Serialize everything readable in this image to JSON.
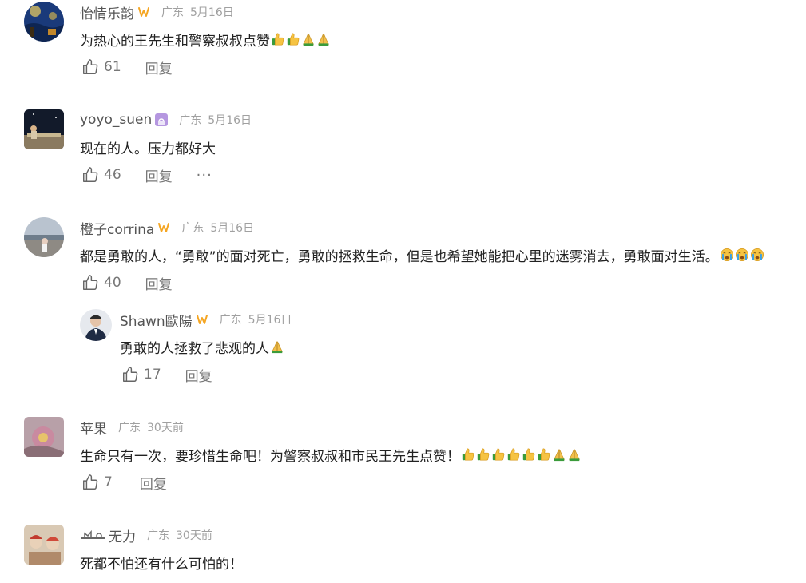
{
  "comments": [
    {
      "name": "怡情乐韵",
      "badge": "w",
      "location": "广东",
      "date": "5月16日",
      "text": "为热心的王先生和警察叔叔点赞",
      "emojis": [
        "thumbs-up",
        "thumbs-up",
        "pray",
        "pray"
      ],
      "likes": "61",
      "reply": "回复"
    },
    {
      "name": "yoyo_suen",
      "badge": "libra",
      "location": "广东",
      "date": "5月16日",
      "text": "现在的人。压力都好大",
      "emojis": [],
      "likes": "46",
      "reply": "回复",
      "more": "···"
    },
    {
      "name": "橙子corrina",
      "badge": "w",
      "location": "广东",
      "date": "5月16日",
      "text": "都是勇敢的人，“勇敢”的面对死亡，勇敢的拯救生命，但是也希望她能把心里的迷雾消去，勇敢面对生活。",
      "emojis": [
        "crying",
        "crying",
        "crying"
      ],
      "likes": "40",
      "reply": "回复"
    },
    {
      "name": "Shawn歐陽",
      "badge": "w",
      "location": "广东",
      "date": "5月16日",
      "text": "勇敢的人拯救了悲观的人",
      "emojis": [
        "pray"
      ],
      "likes": "17",
      "reply": "回复"
    },
    {
      "name": "苹果",
      "location": "广东",
      "date": "30天前",
      "text": "生命只有一次，要珍惜生命吧！为警察叔叔和市民王先生点赞！",
      "emojis": [
        "thumbs-up",
        "thumbs-up",
        "thumbs-up",
        "thumbs-up",
        "thumbs-up",
        "thumbs-up",
        "pray",
        "pray"
      ],
      "likes": "7",
      "reply": "回复"
    },
    {
      "name": "无力",
      "location": "广东",
      "date": "30天前",
      "text": "死都不怕还有什么可怕的！"
    }
  ],
  "colors": {
    "name": "#555555",
    "meta": "#a0a0a0",
    "text": "#222222",
    "action": "#777777",
    "badge_orange": "#f5a623",
    "badge_purple": "#b597e0"
  }
}
